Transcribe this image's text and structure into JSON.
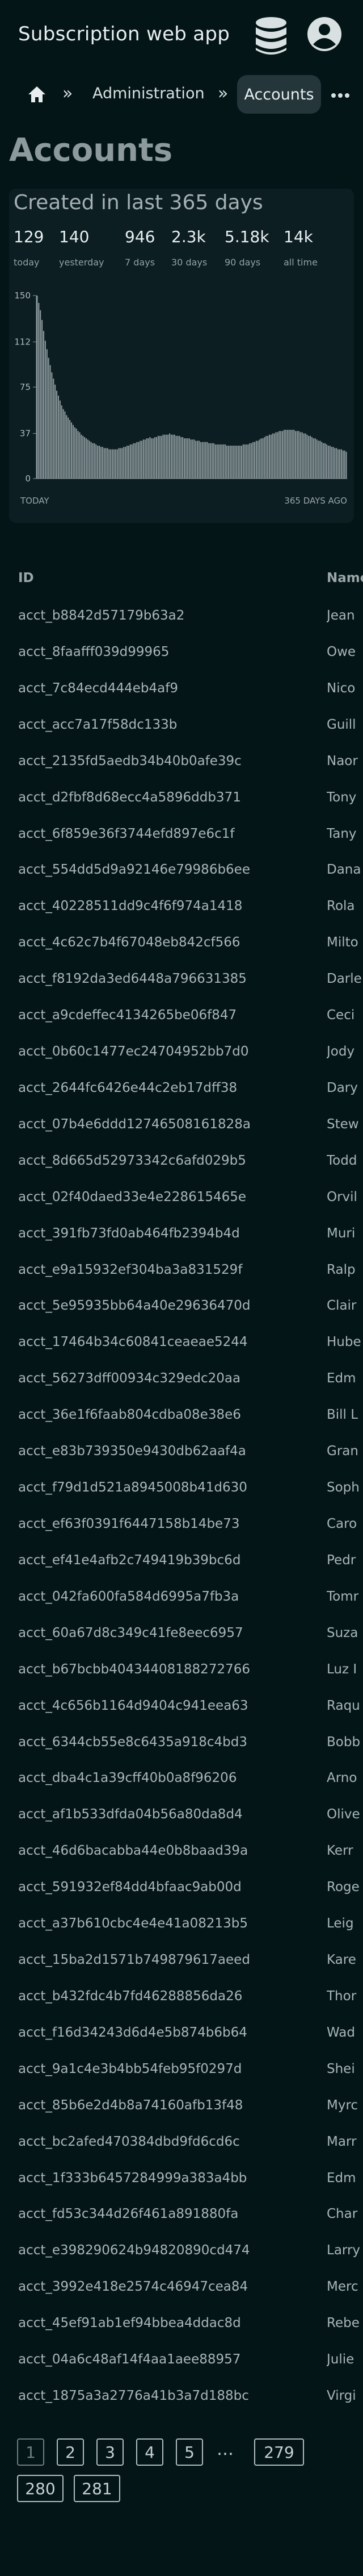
{
  "app": {
    "title": "Subscription web app",
    "db_icon": "database-icon",
    "user_icon": "user-circle-icon"
  },
  "breadcrumb": {
    "home_icon": "home-icon",
    "separator": "»",
    "items": [
      {
        "label": "Administration"
      },
      {
        "label": "Accounts"
      }
    ],
    "more_icon": "more-horizontal-icon"
  },
  "page": {
    "title": "Accounts"
  },
  "stats": {
    "heading": "Created in last 365 days",
    "items": [
      {
        "value": "129",
        "label": "today"
      },
      {
        "value": "140",
        "label": "yesterday"
      },
      {
        "value": "946",
        "label": "7 days"
      },
      {
        "value": "2.3k",
        "label": "30 days"
      },
      {
        "value": "5.18k",
        "label": "90 days"
      },
      {
        "value": "14k",
        "label": "all time"
      }
    ]
  },
  "chart_data": {
    "type": "bar",
    "ylim": [
      0,
      150
    ],
    "yticks": [
      "150",
      "112",
      "75",
      "37",
      "0"
    ],
    "x_start_label": "TODAY",
    "x_end_label": "365 DAYS AGO",
    "values": [
      150,
      144,
      138,
      130,
      121,
      113,
      106,
      99,
      93,
      87,
      82,
      77,
      72,
      68,
      64,
      60,
      57,
      55,
      52,
      50,
      48,
      46,
      44,
      42,
      41,
      39,
      38,
      36,
      35,
      34,
      33,
      32,
      31,
      30,
      29,
      29,
      28,
      27,
      27,
      26,
      26,
      25,
      25,
      25,
      24,
      24,
      24,
      24,
      24,
      24,
      25,
      25,
      25,
      26,
      26,
      27,
      27,
      28,
      28,
      29,
      29,
      30,
      30,
      31,
      31,
      32,
      32,
      33,
      33,
      34,
      33,
      33,
      34,
      34,
      35,
      35,
      35,
      36,
      36,
      36,
      36,
      37,
      36,
      36,
      36,
      35,
      35,
      35,
      34,
      34,
      33,
      33,
      33,
      33,
      32,
      32,
      32,
      31,
      31,
      31,
      30,
      30,
      30,
      30,
      30,
      29,
      29,
      29,
      29,
      28,
      28,
      28,
      28,
      28,
      28,
      28,
      27,
      27,
      27,
      27,
      27,
      27,
      27,
      27,
      27,
      27,
      28,
      28,
      28,
      28,
      29,
      29,
      30,
      30,
      31,
      31,
      32,
      33,
      33,
      34,
      35,
      35,
      36,
      36,
      37,
      37,
      38,
      38,
      39,
      39,
      39,
      40,
      40,
      40,
      40,
      40,
      40,
      40,
      39,
      39,
      39,
      38,
      38,
      37,
      37,
      36,
      35,
      35,
      34,
      33,
      33,
      32,
      31,
      31,
      30,
      29,
      29,
      28,
      27,
      27,
      26,
      26,
      25,
      25,
      24,
      24,
      24,
      23,
      23,
      22
    ]
  },
  "table": {
    "columns": [
      "ID",
      "Name"
    ],
    "rows": [
      {
        "id": "acct_b8842d57179b63a2",
        "name": "Jean"
      },
      {
        "id": "acct_8faafff039d99965",
        "name": "Owe"
      },
      {
        "id": "acct_7c84ecd444eb4af9",
        "name": "Nico"
      },
      {
        "id": "acct_acc7a17f58dc133b",
        "name": "Guill"
      },
      {
        "id": "acct_2135fd5aedb34b40b0afe39c",
        "name": "Naor"
      },
      {
        "id": "acct_d2fbf8d68ecc4a5896ddb371",
        "name": "Tony"
      },
      {
        "id": "acct_6f859e36f3744efd897e6c1f",
        "name": "Tany"
      },
      {
        "id": "acct_554dd5d9a92146e79986b6ee",
        "name": "Dana"
      },
      {
        "id": "acct_40228511dd9c4f6f974a1418",
        "name": "Rola"
      },
      {
        "id": "acct_4c62c7b4f67048eb842cf566",
        "name": "Milto"
      },
      {
        "id": "acct_f8192da3ed6448a796631385",
        "name": "Darle"
      },
      {
        "id": "acct_a9cdeffec4134265be06f847",
        "name": "Ceci"
      },
      {
        "id": "acct_0b60c1477ec24704952bb7d0",
        "name": "Jody"
      },
      {
        "id": "acct_2644fc6426e44c2eb17dff38",
        "name": "Dary"
      },
      {
        "id": "acct_07b4e6ddd12746508161828a",
        "name": "Stew"
      },
      {
        "id": "acct_8d665d52973342c6afd029b5",
        "name": "Todd"
      },
      {
        "id": "acct_02f40daed33e4e228615465e",
        "name": "Orvil"
      },
      {
        "id": "acct_391fb73fd0ab464fb2394b4d",
        "name": "Muri"
      },
      {
        "id": "acct_e9a15932ef304ba3a831529f",
        "name": "Ralp"
      },
      {
        "id": "acct_5e95935bb64a40e29636470d",
        "name": "Clair"
      },
      {
        "id": "acct_17464b34c60841ceaeae5244",
        "name": "Hube"
      },
      {
        "id": "acct_56273dff00934c329edc20aa",
        "name": "Edm"
      },
      {
        "id": "acct_36e1f6faab804cdba08e38e6",
        "name": "Bill L"
      },
      {
        "id": "acct_e83b739350e9430db62aaf4a",
        "name": "Gran"
      },
      {
        "id": "acct_f79d1d521a8945008b41d630",
        "name": "Soph"
      },
      {
        "id": "acct_ef63f0391f6447158b14be73",
        "name": "Caro"
      },
      {
        "id": "acct_ef41e4afb2c749419b39bc6d",
        "name": "Pedr"
      },
      {
        "id": "acct_042fa600fa584d6995a7fb3a",
        "name": "Tomr"
      },
      {
        "id": "acct_60a67d8c349c41fe8eec6957",
        "name": "Suza"
      },
      {
        "id": "acct_b67bcbb40434408188272766",
        "name": "Luz I"
      },
      {
        "id": "acct_4c656b1164d9404c941eea63",
        "name": "Raqu"
      },
      {
        "id": "acct_6344cb55e8c6435a918c4bd3",
        "name": "Bobb"
      },
      {
        "id": "acct_dba4c1a39cff40b0a8f96206",
        "name": "Arno"
      },
      {
        "id": "acct_af1b533dfda04b56a80da8d4",
        "name": "Olive"
      },
      {
        "id": "acct_46d6bacabba44e0b8baad39a",
        "name": "Kerr"
      },
      {
        "id": "acct_591932ef84dd4bfaac9ab00d",
        "name": "Roge"
      },
      {
        "id": "acct_a37b610cbc4e4e41a08213b5",
        "name": "Leig"
      },
      {
        "id": "acct_15ba2d1571b749879617aeed",
        "name": "Kare"
      },
      {
        "id": "acct_b432fdc4b7fd46288856da26",
        "name": "Thor"
      },
      {
        "id": "acct_f16d34243d6d4e5b874b6b64",
        "name": "Wad"
      },
      {
        "id": "acct_9a1c4e3b4bb54feb95f0297d",
        "name": "Shei"
      },
      {
        "id": "acct_85b6e2d4b8a74160afb13f48",
        "name": "Myrc"
      },
      {
        "id": "acct_bc2afed470384dbd9fd6cd6c",
        "name": "Marr"
      },
      {
        "id": "acct_1f333b6457284999a383a4bb",
        "name": "Edm"
      },
      {
        "id": "acct_fd53c344d26f461a891880fa",
        "name": "Char"
      },
      {
        "id": "acct_e398290624b94820890cd474",
        "name": "Larry"
      },
      {
        "id": "acct_3992e418e2574c46947cea84",
        "name": "Merc"
      },
      {
        "id": "acct_45ef91ab1ef94bbea4ddac8d",
        "name": "Rebe"
      },
      {
        "id": "acct_04a6c48af14f4aa1aee88957",
        "name": "Julie"
      },
      {
        "id": "acct_1875a3a2776a41b3a7d188bc",
        "name": "Virgi"
      }
    ]
  },
  "pagination": {
    "pages": [
      "1",
      "2",
      "3",
      "4",
      "5"
    ],
    "ellipsis": "…",
    "last_pages": [
      "279",
      "280",
      "281"
    ],
    "current": "1"
  },
  "colors": {
    "background": "#041518",
    "card": "#0c1e22",
    "chart_bar": "#8d9a9d",
    "active_crumb": "#24363a"
  }
}
